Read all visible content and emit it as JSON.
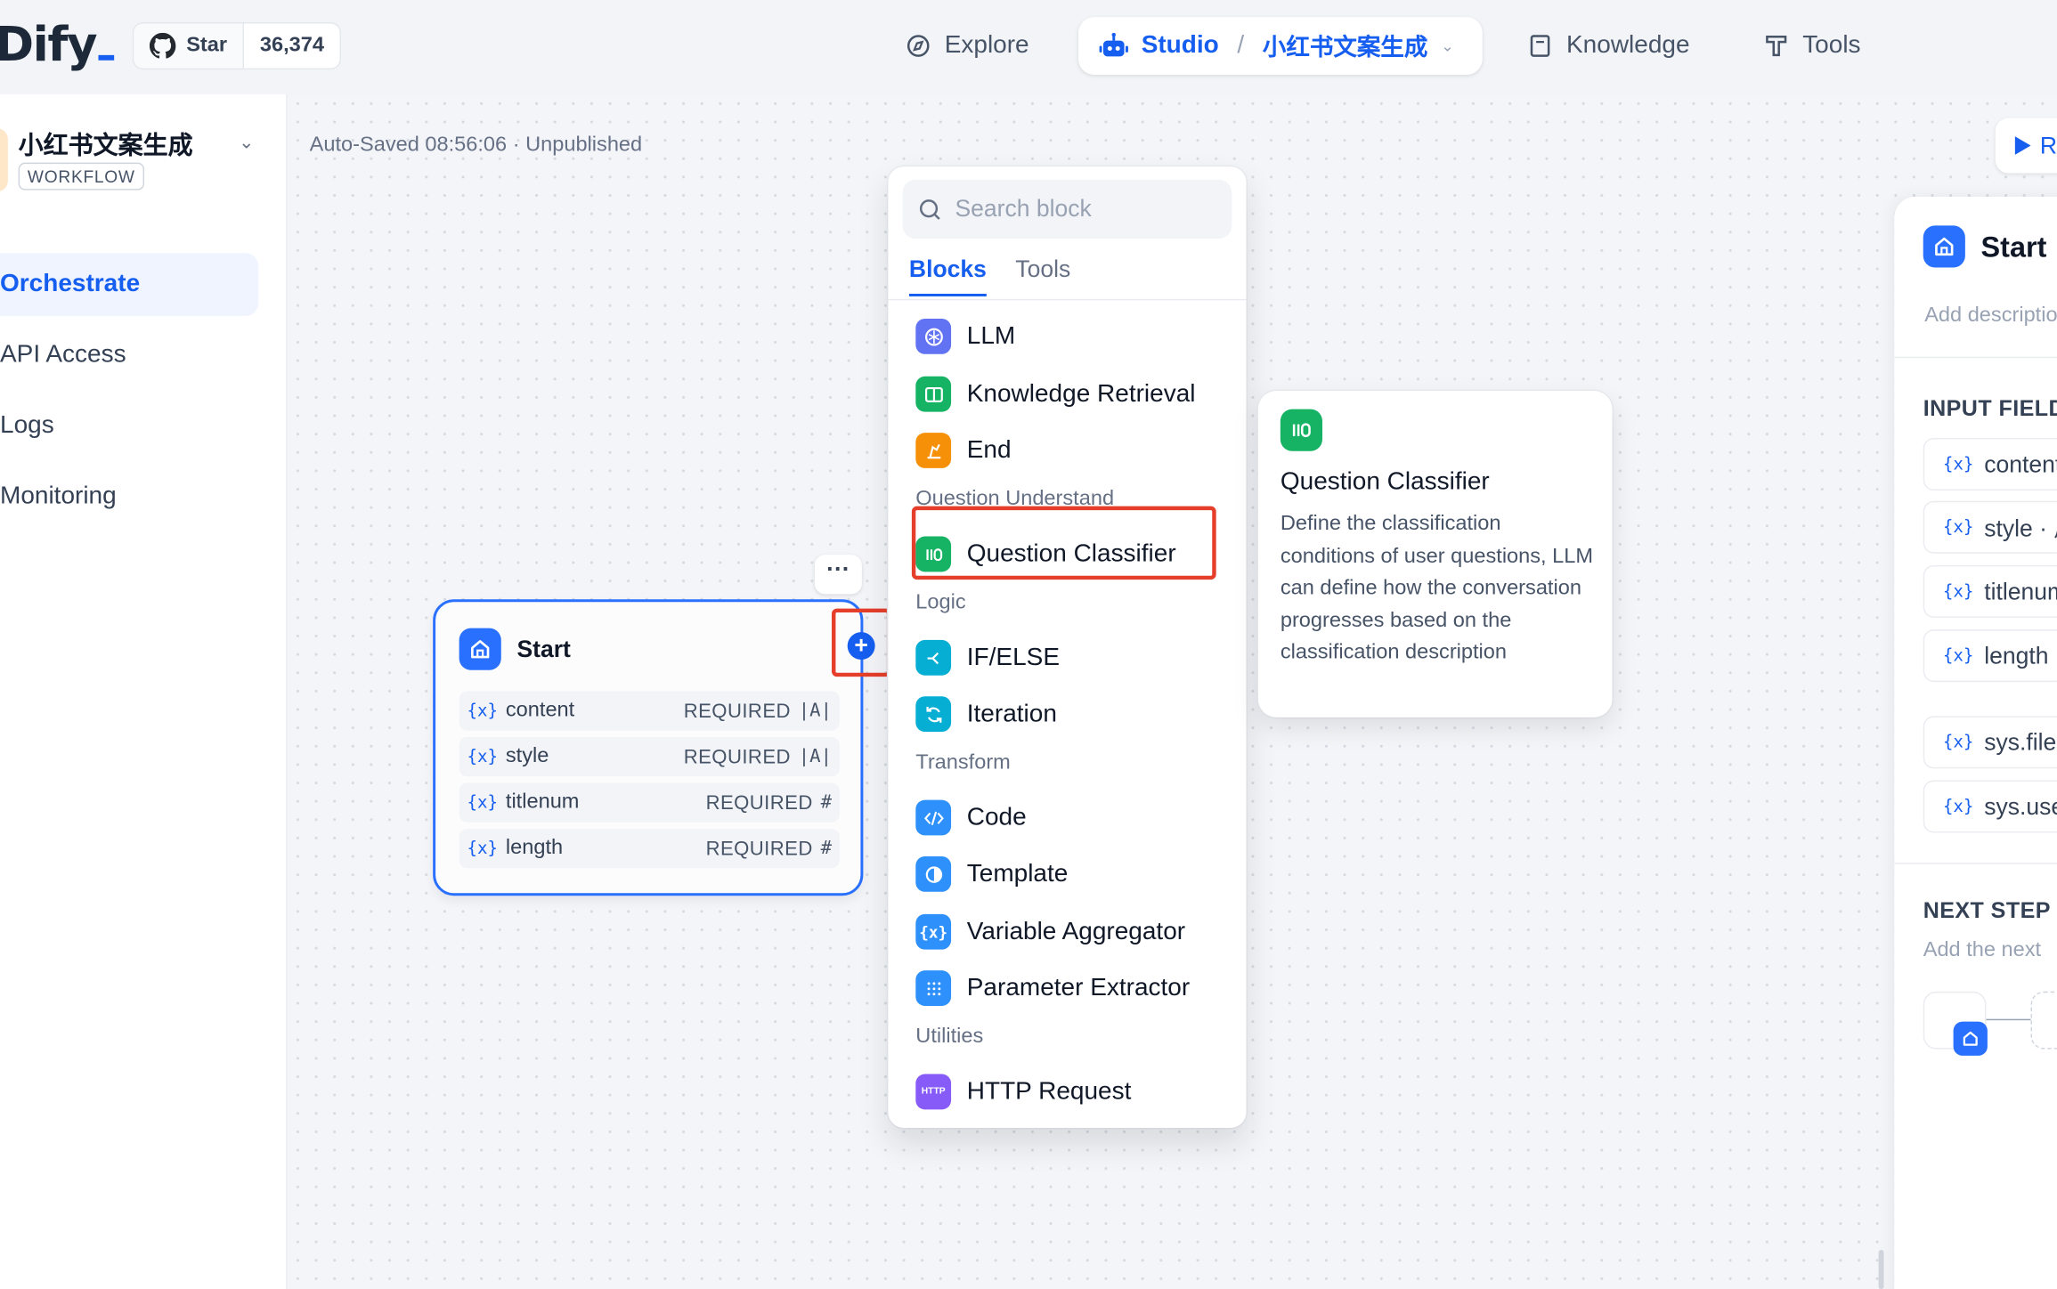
{
  "header": {
    "logo": "Dify",
    "github": {
      "label": "Star",
      "count": "36,374"
    },
    "nav": {
      "explore": "Explore",
      "studio": "Studio",
      "separator": "/",
      "current_app": "小红书文案生成",
      "knowledge": "Knowledge",
      "tools": "Tools"
    }
  },
  "sidebar": {
    "app_name": "小红书文案生成",
    "app_type": "WORKFLOW",
    "items": [
      {
        "label": "Orchestrate",
        "active": true
      },
      {
        "label": "API Access",
        "active": false
      },
      {
        "label": "Logs",
        "active": false
      },
      {
        "label": "Monitoring",
        "active": false
      }
    ]
  },
  "canvas": {
    "status": "Auto-Saved 08:56:06 · Unpublished",
    "run_label": "R",
    "more_label": "···",
    "start_node": {
      "title": "Start",
      "variables": [
        {
          "name": "content",
          "required": "REQUIRED",
          "type": "|A|"
        },
        {
          "name": "style",
          "required": "REQUIRED",
          "type": "|A|"
        },
        {
          "name": "titlenum",
          "required": "REQUIRED",
          "type": "#"
        },
        {
          "name": "length",
          "required": "REQUIRED",
          "type": "#"
        }
      ]
    }
  },
  "block_menu": {
    "search_placeholder": "Search block",
    "tabs": [
      "Blocks",
      "Tools"
    ],
    "blocks_top": [
      "LLM",
      "Knowledge Retrieval",
      "End"
    ],
    "cat_question": "Question Understand",
    "question_classifier": "Question Classifier",
    "cat_logic": "Logic",
    "if_else": "IF/ELSE",
    "iteration": "Iteration",
    "cat_transform": "Transform",
    "code": "Code",
    "template": "Template",
    "variable_aggregator": "Variable Aggregator",
    "parameter_extractor": "Parameter Extractor",
    "cat_utilities": "Utilities",
    "http_request": "HTTP Request",
    "http_icon_text": "HTTP"
  },
  "tooltip": {
    "title": "Question Classifier",
    "description": "Define the classification conditions of user questions, LLM can define how the conversation progresses based on the classification description"
  },
  "right_panel": {
    "title": "Start",
    "description": "Add description",
    "input_fields_label": "INPUT FIELD",
    "fields": [
      "content",
      "style · 風",
      "titlenum",
      "length ·"
    ],
    "system_fields": [
      "sys.files",
      "sys.user"
    ],
    "next_step_label": "NEXT STEP",
    "next_step_desc": "Add the next"
  },
  "colors": {
    "accent": "#155eef",
    "highlight": "#e53e2a",
    "llm": "#6172f3",
    "knowledge": "#16b364",
    "end": "#f79009",
    "classifier": "#16b364",
    "logic": "#06aed4",
    "code": "#2e90fa",
    "http": "#875bf7"
  }
}
